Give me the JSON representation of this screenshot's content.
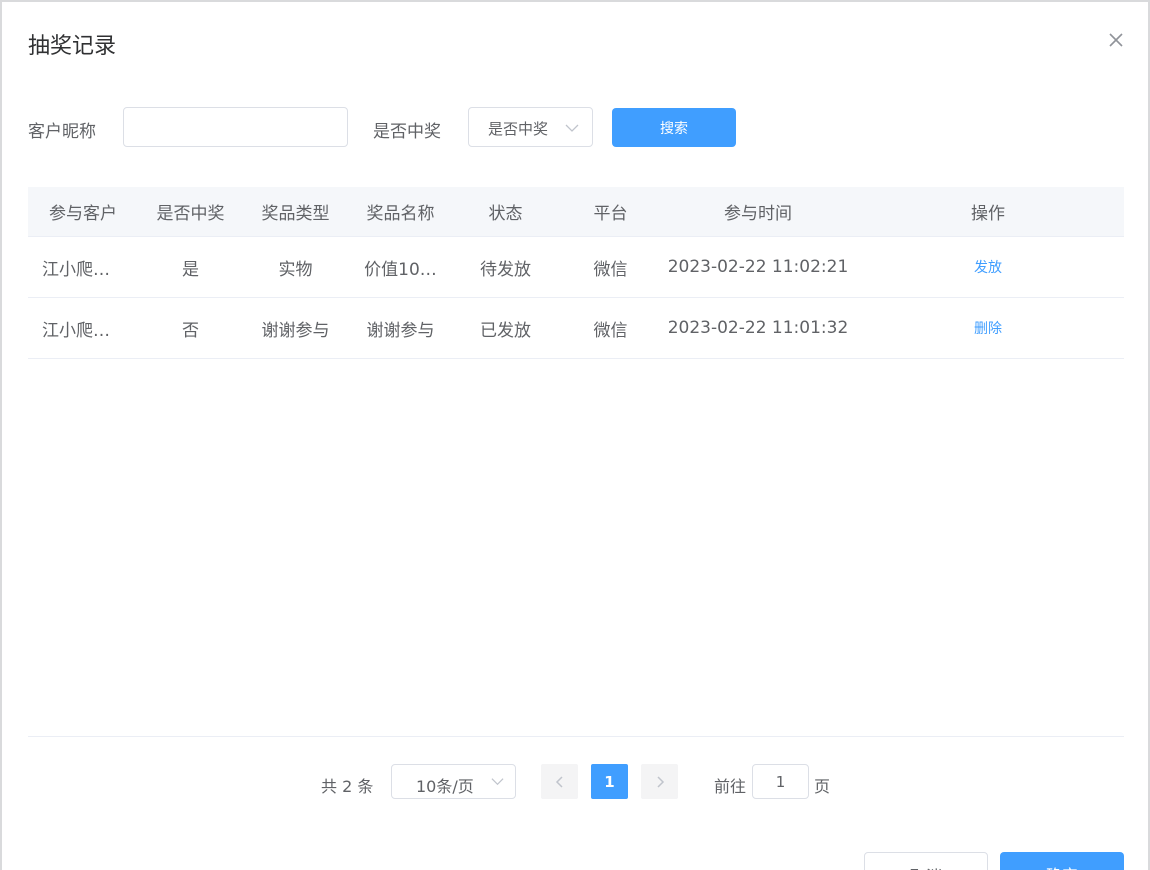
{
  "dialog": {
    "title": "抽奖记录"
  },
  "filters": {
    "nickname_label": "客户昵称",
    "nickname_value": "",
    "winning_label": "是否中奖",
    "winning_select_value": "是否中奖",
    "search_label": "搜索"
  },
  "table": {
    "columns": [
      "参与客户",
      "是否中奖",
      "奖品类型",
      "奖品名称",
      "状态",
      "平台",
      "参与时间",
      "操作"
    ],
    "rows": [
      {
        "customer": "江小爬…",
        "won": "是",
        "prize_type": "实物",
        "prize_name": "价值10…",
        "status": "待发放",
        "platform": "微信",
        "time": "2023-02-22 11:02:21",
        "action": "发放"
      },
      {
        "customer": "江小爬…",
        "won": "否",
        "prize_type": "谢谢参与",
        "prize_name": "谢谢参与",
        "status": "已发放",
        "platform": "微信",
        "time": "2023-02-22 11:01:32",
        "action": "删除"
      }
    ]
  },
  "pagination": {
    "total_text": "共 2 条",
    "page_size": "10条/页",
    "current_page": "1",
    "goto_label": "前往",
    "goto_value": "1",
    "page_suffix": "页"
  },
  "footer": {
    "cancel_label": "取消",
    "confirm_label": "确定"
  },
  "colors": {
    "primary": "#409eff",
    "header_bg": "#f5f7fa",
    "border": "#dcdfe6"
  }
}
